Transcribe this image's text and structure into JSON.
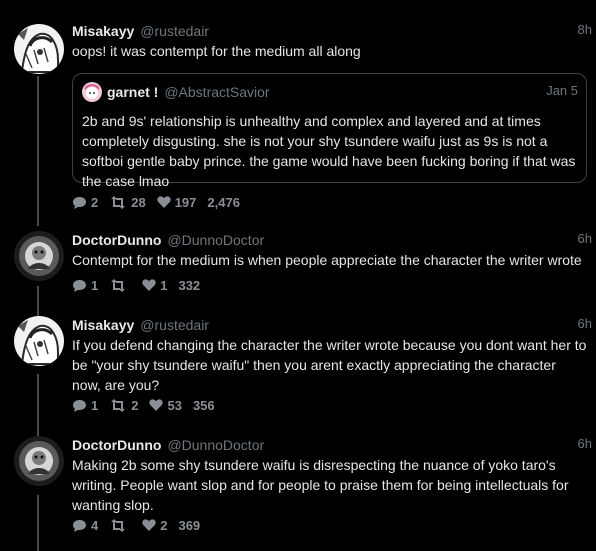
{
  "tweets": [
    {
      "name": "Misakayy",
      "handle": "@rustedair",
      "time": "8h",
      "text": "oops! it was contempt for the medium all along",
      "quote": {
        "name": "garnet !",
        "handle": "@AbstractSavior",
        "time": "Jan 5",
        "text": "2b and 9s' relationship is unhealthy and complex and layered and at times completely disgusting. she is not your shy tsundere waifu just as 9s is not a softboi gentle baby prince. the game would have been fucking boring if that was the case lmao"
      },
      "replies": "2",
      "retweets": "28",
      "likes": "197",
      "views": "2,476"
    },
    {
      "name": "DoctorDunno",
      "handle": "@DunnoDoctor",
      "time": "6h",
      "text": "Contempt for the medium is when people appreciate the character the writer wrote",
      "replies": "1",
      "retweets": "",
      "likes": "1",
      "views": "332"
    },
    {
      "name": "Misakayy",
      "handle": "@rustedair",
      "time": "6h",
      "text": "If you defend changing the character the writer wrote because you dont want her to be \"your shy tsundere waifu\" then you arent exactly appreciating the character now, are you?",
      "replies": "1",
      "retweets": "2",
      "likes": "53",
      "views": "356"
    },
    {
      "name": "DoctorDunno",
      "handle": "@DunnoDoctor",
      "time": "6h",
      "text": "Making 2b some shy tsundere waifu is disrespecting the nuance of yoko taro's writing. People want slop and for people to praise them for being intellectuals for wanting slop.",
      "replies": "4",
      "retweets": "",
      "likes": "2",
      "views": "369"
    }
  ],
  "icons": {
    "reply": "reply-icon",
    "retweet": "retweet-icon",
    "like": "heart-icon"
  },
  "colors": {
    "background": "#000000",
    "thread_line": "#3d4f45",
    "muted": "#6e767d"
  }
}
